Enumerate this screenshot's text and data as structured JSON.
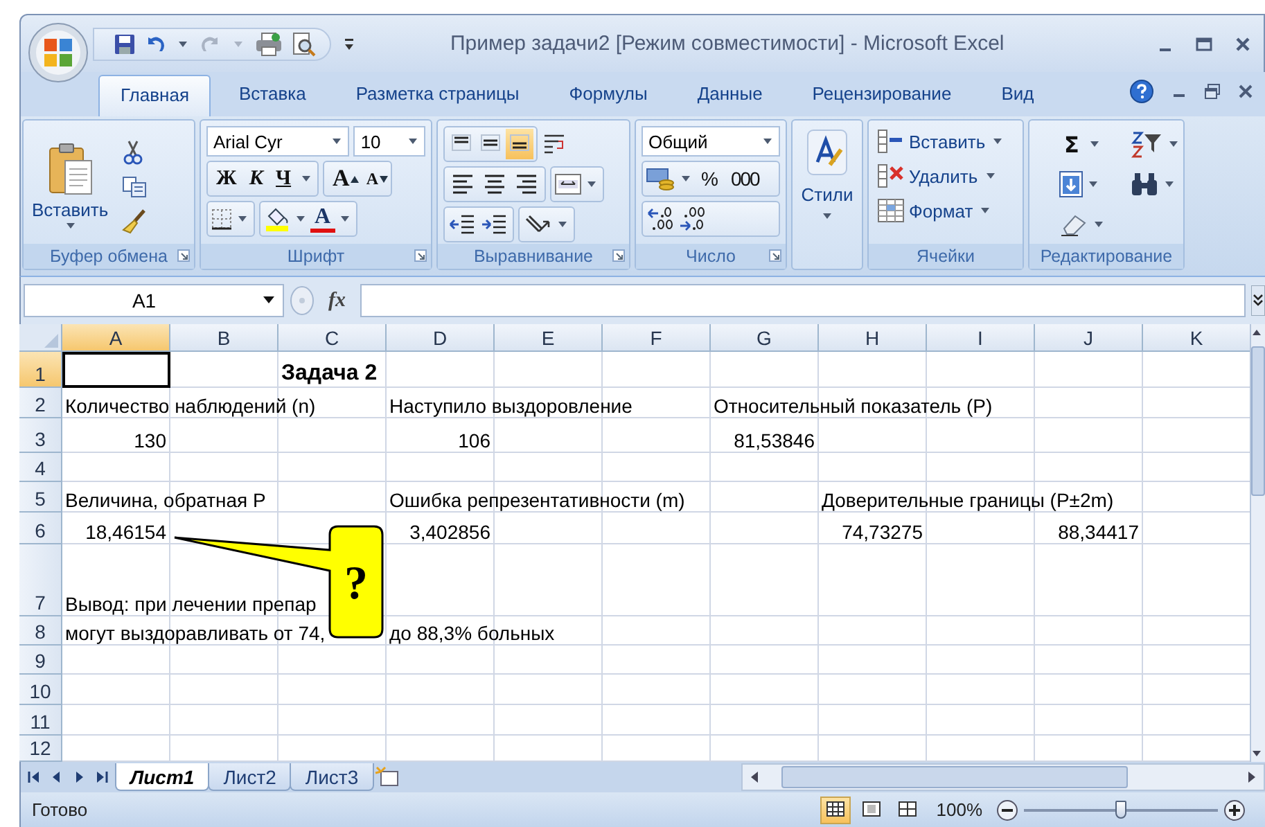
{
  "window": {
    "title": "Пример задачи2  [Режим совместимости] - Microsoft Excel"
  },
  "ribbon_tabs": [
    {
      "label": "Главная",
      "selected": true
    },
    {
      "label": "Вставка",
      "selected": false
    },
    {
      "label": "Разметка страницы",
      "selected": false
    },
    {
      "label": "Формулы",
      "selected": false
    },
    {
      "label": "Данные",
      "selected": false
    },
    {
      "label": "Рецензирование",
      "selected": false
    },
    {
      "label": "Вид",
      "selected": false
    }
  ],
  "clipboard": {
    "paste": "Вставить",
    "label": "Буфер обмена"
  },
  "font": {
    "name": "Arial Cyr",
    "size": "10",
    "bold": "Ж",
    "italic": "К",
    "underline": "Ч",
    "grow": "A",
    "shrink": "A",
    "font_color": "A",
    "label": "Шрифт"
  },
  "alignment": {
    "vertical": [
      {
        "selected": false
      },
      {
        "selected": false
      },
      {
        "selected": true
      }
    ],
    "label": "Выравнивание"
  },
  "number": {
    "format": "Общий",
    "percent": "%",
    "thousands": "000",
    "label": "Число"
  },
  "styles": {
    "label": "Стили"
  },
  "cells_group": {
    "insert": "Вставить",
    "delete": "Удалить",
    "format": "Формат",
    "label": "Ячейки"
  },
  "editing": {
    "sum": "Σ",
    "label": "Редактирование"
  },
  "formula_bar": {
    "name_box": "A1",
    "fx": "fx"
  },
  "columns": [
    {
      "label": "A",
      "selected": true
    },
    {
      "label": "B",
      "selected": false
    },
    {
      "label": "C",
      "selected": false
    },
    {
      "label": "D",
      "selected": false
    },
    {
      "label": "E",
      "selected": false
    },
    {
      "label": "F",
      "selected": false
    },
    {
      "label": "G",
      "selected": false
    },
    {
      "label": "H",
      "selected": false
    },
    {
      "label": "I",
      "selected": false
    },
    {
      "label": "J",
      "selected": false
    },
    {
      "label": "K",
      "selected": false
    }
  ],
  "rows": [
    {
      "number": "1",
      "selected": true,
      "cells": [
        {
          "selected": true
        },
        {},
        {
          "text": "Задача 2",
          "bold": true
        }
      ]
    },
    {
      "number": "2",
      "selected": false,
      "cells": [
        {
          "text": "Количество наблюдений (n)",
          "align_right": false
        },
        {},
        {},
        {
          "text": "Наступило выздоровление",
          "align_right": false
        },
        {},
        {},
        {
          "text": "Относительный показатель (P)",
          "align_right": false
        }
      ]
    },
    {
      "number": "3",
      "selected": false,
      "cells": [
        {
          "text": "130",
          "align_right": true
        },
        {},
        {},
        {
          "text": "106",
          "align_right": true
        },
        {},
        {},
        {
          "text": "81,53846",
          "align_right": true
        }
      ]
    },
    {
      "number": "4",
      "selected": false,
      "cells": []
    },
    {
      "number": "5",
      "selected": false,
      "cells": [
        {
          "text": "Величина, обратная P",
          "align_right": false
        },
        {},
        {},
        {
          "text": "Ошибка репрезентативности (m)",
          "align_right": false
        },
        {},
        {},
        {},
        {
          "text": "Доверительные границы (P±2m)",
          "align_right": false
        }
      ]
    },
    {
      "number": "6",
      "selected": false,
      "cells": [
        {
          "text": "18,46154",
          "align_right": true
        },
        {},
        {},
        {
          "text": "3,402856",
          "align_right": true
        },
        {},
        {},
        {},
        {
          "text": "74,73275",
          "align_right": true
        },
        {},
        {
          "text": "88,34417",
          "align_right": true
        }
      ]
    },
    {
      "number": "7",
      "selected": false,
      "cells": [
        {
          "text": "Вывод: при лечении препар",
          "align_right": false
        }
      ]
    },
    {
      "number": "8",
      "selected": false,
      "cells": [
        {
          "text": "могут выздоравливать от 74,",
          "align_right": false
        },
        {},
        {},
        {
          "text": "до 88,3% больных",
          "align_right": false
        }
      ]
    },
    {
      "number": "9",
      "selected": false,
      "cells": []
    },
    {
      "number": "10",
      "selected": false,
      "cells": []
    },
    {
      "number": "11",
      "selected": false,
      "cells": []
    },
    {
      "number": "12",
      "selected": false,
      "cells": []
    }
  ],
  "callout": {
    "text": "?"
  },
  "sheet_tabs": [
    {
      "label": "Лист1",
      "selected": true
    },
    {
      "label": "Лист2",
      "selected": false
    },
    {
      "label": "Лист3",
      "selected": false
    }
  ],
  "status_bar": {
    "text": "Готово",
    "views": [
      {
        "selected": true
      },
      {
        "selected": false
      },
      {
        "selected": false
      }
    ],
    "zoom": "100%",
    "zoom_slider": {
      "level": 0.5
    }
  }
}
